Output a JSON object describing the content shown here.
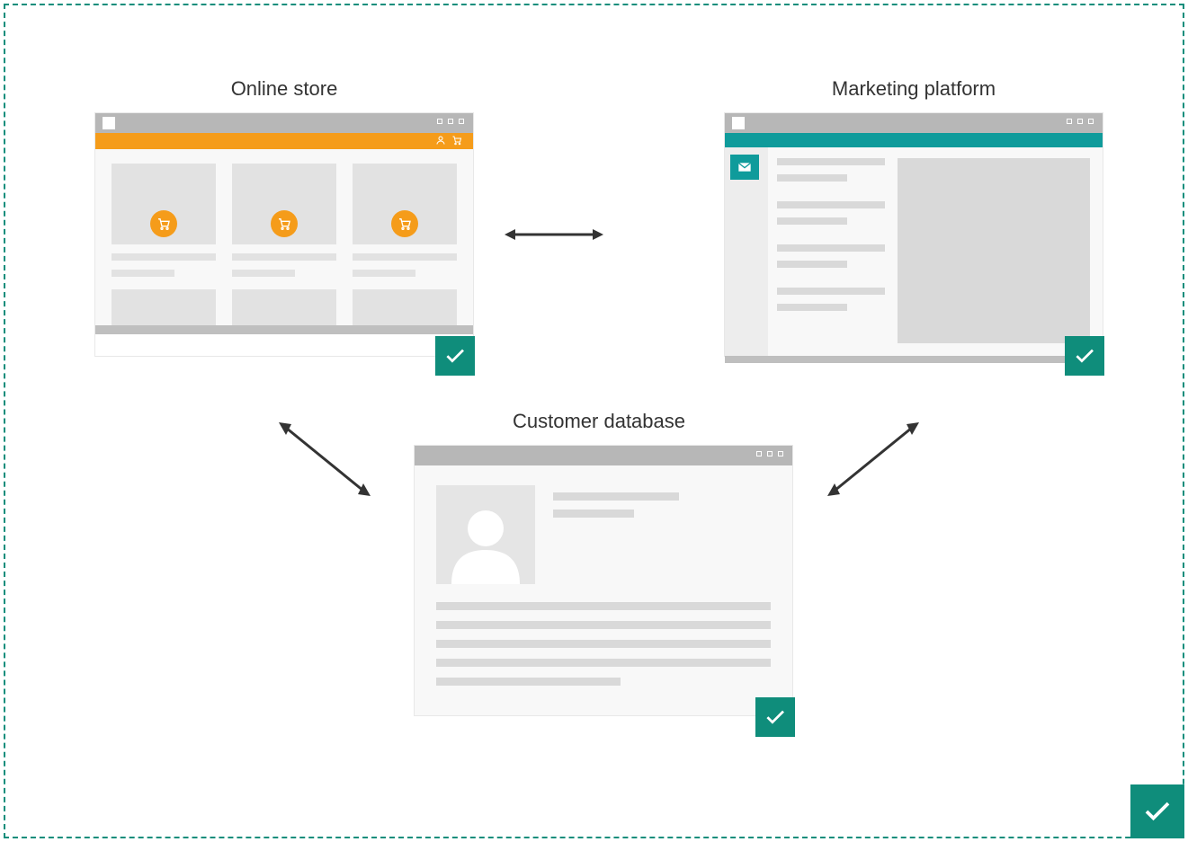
{
  "labels": {
    "store": "Online store",
    "marketing": "Marketing platform",
    "customer": "Customer database"
  },
  "colors": {
    "teal": "#0f8d7b",
    "orange": "#f59c1a",
    "teal_bar": "#0f9b9b",
    "grey_bar": "#b7b7b7"
  },
  "icons": {
    "cart": "cart-icon",
    "user": "user-icon",
    "mail": "mail-icon",
    "check": "check-icon"
  }
}
